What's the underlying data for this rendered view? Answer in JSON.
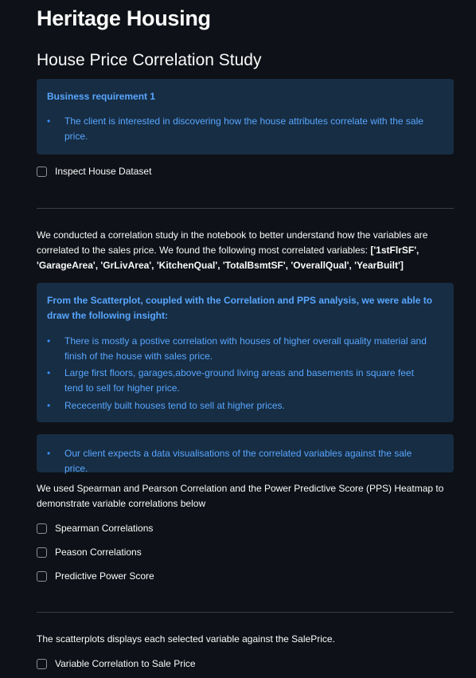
{
  "header": {
    "title": "Heritage Housing",
    "subtitle": "House Price Correlation Study"
  },
  "business_requirement_box": {
    "title": "Business requirement 1",
    "bullets": [
      "The client is interested in discovering how the house attributes correlate with the sale price."
    ]
  },
  "checkboxes": {
    "inspect_dataset": "Inspect House Dataset",
    "spearman": "Spearman Correlations",
    "pearson": "Peason Correlations",
    "pps": "Predictive Power Score",
    "variable_correlation": "Variable Correlation to Sale Price"
  },
  "correlation_paragraph": {
    "text": "We conducted a correlation study in the notebook to better understand how the variables are correlated to the sales price. We found the following most correlated variables: ",
    "variables": "['1stFlrSF', 'GarageArea', 'GrLivArea', 'KitchenQual', 'TotalBsmtSF', 'OverallQual', 'YearBuilt']"
  },
  "insight_box": {
    "title": "From the Scatterplot, coupled with the Correlation and PPS analysis, we were able to draw the following insight:",
    "bullets": [
      "There is mostly a postive correlation with houses of higher overall quality material and finish of the house with sales price.",
      "Large first floors, garages,above-ground living areas and basements in square feet tend to sell for higher price.",
      "Rececently built houses tend to sell at higher prices."
    ]
  },
  "client_box": {
    "bullets": [
      "Our client expects a data visualisations of the correlated variables against the sale price."
    ]
  },
  "heatmap_paragraph": "We used Spearman and Pearson Correlation and the Power Predictive Score (PPS) Heatmap to demonstrate variable correlations below",
  "scatter_paragraph": "The scatterplots displays each selected variable against the SalePrice."
}
